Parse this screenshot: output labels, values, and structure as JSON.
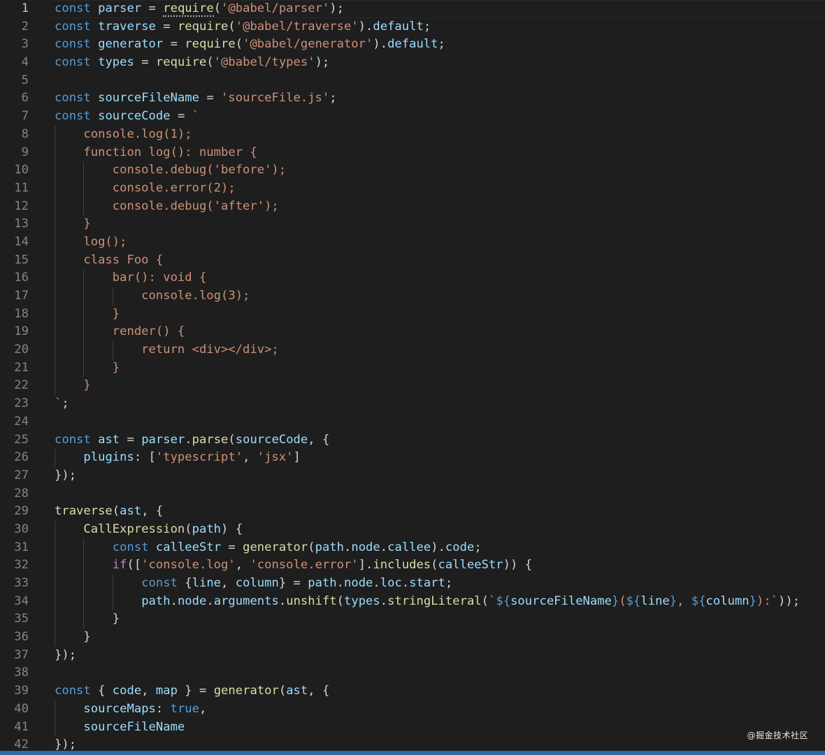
{
  "editor": {
    "current_line": 1,
    "lines": [
      {
        "n": "1",
        "indent": 0,
        "t": [
          [
            "kw",
            "const"
          ],
          [
            "p",
            " "
          ],
          [
            "var",
            "parser"
          ],
          [
            "p",
            " = "
          ],
          [
            "fn",
            "require"
          ],
          [
            "p",
            "("
          ],
          [
            "str",
            "'@babel/parser'"
          ],
          [
            "p",
            ");"
          ]
        ]
      },
      {
        "n": "2",
        "indent": 0,
        "t": [
          [
            "kw",
            "const"
          ],
          [
            "p",
            " "
          ],
          [
            "var",
            "traverse"
          ],
          [
            "p",
            " = "
          ],
          [
            "fn",
            "require"
          ],
          [
            "p",
            "("
          ],
          [
            "str",
            "'@babel/traverse'"
          ],
          [
            "p",
            ")."
          ],
          [
            "prop",
            "default"
          ],
          [
            "p",
            ";"
          ]
        ]
      },
      {
        "n": "3",
        "indent": 0,
        "t": [
          [
            "kw",
            "const"
          ],
          [
            "p",
            " "
          ],
          [
            "var",
            "generator"
          ],
          [
            "p",
            " = "
          ],
          [
            "fn",
            "require"
          ],
          [
            "p",
            "("
          ],
          [
            "str",
            "'@babel/generator'"
          ],
          [
            "p",
            ")."
          ],
          [
            "prop",
            "default"
          ],
          [
            "p",
            ";"
          ]
        ]
      },
      {
        "n": "4",
        "indent": 0,
        "t": [
          [
            "kw",
            "const"
          ],
          [
            "p",
            " "
          ],
          [
            "var",
            "types"
          ],
          [
            "p",
            " = "
          ],
          [
            "fn",
            "require"
          ],
          [
            "p",
            "("
          ],
          [
            "str",
            "'@babel/types'"
          ],
          [
            "p",
            ");"
          ]
        ]
      },
      {
        "n": "5",
        "indent": 0,
        "t": []
      },
      {
        "n": "6",
        "indent": 0,
        "t": [
          [
            "kw",
            "const"
          ],
          [
            "p",
            " "
          ],
          [
            "var",
            "sourceFileName"
          ],
          [
            "p",
            " = "
          ],
          [
            "str",
            "'sourceFile.js'"
          ],
          [
            "p",
            ";"
          ]
        ]
      },
      {
        "n": "7",
        "indent": 0,
        "t": [
          [
            "kw",
            "const"
          ],
          [
            "p",
            " "
          ],
          [
            "var",
            "sourceCode"
          ],
          [
            "p",
            " = "
          ],
          [
            "str",
            "`"
          ]
        ]
      },
      {
        "n": "8",
        "indent": 1,
        "t": [
          [
            "str",
            "    console.log(1);"
          ]
        ]
      },
      {
        "n": "9",
        "indent": 1,
        "t": [
          [
            "str",
            "    function log(): number {"
          ]
        ]
      },
      {
        "n": "10",
        "indent": 2,
        "t": [
          [
            "str",
            "        console.debug('before');"
          ]
        ]
      },
      {
        "n": "11",
        "indent": 2,
        "t": [
          [
            "str",
            "        console.error(2);"
          ]
        ]
      },
      {
        "n": "12",
        "indent": 2,
        "t": [
          [
            "str",
            "        console.debug('after');"
          ]
        ]
      },
      {
        "n": "13",
        "indent": 1,
        "t": [
          [
            "str",
            "    }"
          ]
        ]
      },
      {
        "n": "14",
        "indent": 1,
        "t": [
          [
            "str",
            "    log();"
          ]
        ]
      },
      {
        "n": "15",
        "indent": 1,
        "t": [
          [
            "str",
            "    class Foo {"
          ]
        ]
      },
      {
        "n": "16",
        "indent": 2,
        "t": [
          [
            "str",
            "        bar(): void {"
          ]
        ]
      },
      {
        "n": "17",
        "indent": 3,
        "t": [
          [
            "str",
            "            console.log(3);"
          ]
        ]
      },
      {
        "n": "18",
        "indent": 2,
        "t": [
          [
            "str",
            "        }"
          ]
        ]
      },
      {
        "n": "19",
        "indent": 2,
        "t": [
          [
            "str",
            "        render() {"
          ]
        ]
      },
      {
        "n": "20",
        "indent": 3,
        "t": [
          [
            "str",
            "            return <div></div>;"
          ]
        ]
      },
      {
        "n": "21",
        "indent": 2,
        "t": [
          [
            "str",
            "        }"
          ]
        ]
      },
      {
        "n": "22",
        "indent": 1,
        "t": [
          [
            "str",
            "    }"
          ]
        ]
      },
      {
        "n": "23",
        "indent": 0,
        "t": [
          [
            "str",
            "`"
          ],
          [
            "p",
            ";"
          ]
        ]
      },
      {
        "n": "24",
        "indent": 0,
        "t": []
      },
      {
        "n": "25",
        "indent": 0,
        "t": [
          [
            "kw",
            "const"
          ],
          [
            "p",
            " "
          ],
          [
            "var",
            "ast"
          ],
          [
            "p",
            " = "
          ],
          [
            "var",
            "parser"
          ],
          [
            "p",
            "."
          ],
          [
            "fn",
            "parse"
          ],
          [
            "p",
            "("
          ],
          [
            "var",
            "sourceCode"
          ],
          [
            "p",
            ", {"
          ]
        ]
      },
      {
        "n": "26",
        "indent": 1,
        "t": [
          [
            "p",
            "    "
          ],
          [
            "prop",
            "plugins"
          ],
          [
            "p",
            ": ["
          ],
          [
            "str",
            "'typescript'"
          ],
          [
            "p",
            ", "
          ],
          [
            "str",
            "'jsx'"
          ],
          [
            "p",
            "]"
          ]
        ]
      },
      {
        "n": "27",
        "indent": 0,
        "t": [
          [
            "p",
            "});"
          ]
        ]
      },
      {
        "n": "28",
        "indent": 0,
        "t": []
      },
      {
        "n": "29",
        "indent": 0,
        "t": [
          [
            "fn",
            "traverse"
          ],
          [
            "p",
            "("
          ],
          [
            "var",
            "ast"
          ],
          [
            "p",
            ", {"
          ]
        ]
      },
      {
        "n": "30",
        "indent": 1,
        "t": [
          [
            "p",
            "    "
          ],
          [
            "fn",
            "CallExpression"
          ],
          [
            "p",
            "("
          ],
          [
            "var",
            "path"
          ],
          [
            "p",
            ") {"
          ]
        ]
      },
      {
        "n": "31",
        "indent": 2,
        "t": [
          [
            "p",
            "        "
          ],
          [
            "kw",
            "const"
          ],
          [
            "p",
            " "
          ],
          [
            "var",
            "calleeStr"
          ],
          [
            "p",
            " = "
          ],
          [
            "fn",
            "generator"
          ],
          [
            "p",
            "("
          ],
          [
            "var",
            "path"
          ],
          [
            "p",
            "."
          ],
          [
            "prop",
            "node"
          ],
          [
            "p",
            "."
          ],
          [
            "prop",
            "callee"
          ],
          [
            "p",
            ")."
          ],
          [
            "prop",
            "code"
          ],
          [
            "p",
            ";"
          ]
        ]
      },
      {
        "n": "32",
        "indent": 2,
        "t": [
          [
            "p",
            "        "
          ],
          [
            "ctl",
            "if"
          ],
          [
            "p",
            "(["
          ],
          [
            "str",
            "'console.log'"
          ],
          [
            "p",
            ", "
          ],
          [
            "str",
            "'console.error'"
          ],
          [
            "p",
            "]."
          ],
          [
            "fn",
            "includes"
          ],
          [
            "p",
            "("
          ],
          [
            "var",
            "calleeStr"
          ],
          [
            "p",
            ")) {"
          ]
        ]
      },
      {
        "n": "33",
        "indent": 3,
        "t": [
          [
            "p",
            "            "
          ],
          [
            "kw",
            "const"
          ],
          [
            "p",
            " {"
          ],
          [
            "var",
            "line"
          ],
          [
            "p",
            ", "
          ],
          [
            "var",
            "column"
          ],
          [
            "p",
            "} = "
          ],
          [
            "var",
            "path"
          ],
          [
            "p",
            "."
          ],
          [
            "prop",
            "node"
          ],
          [
            "p",
            "."
          ],
          [
            "prop",
            "loc"
          ],
          [
            "p",
            "."
          ],
          [
            "prop",
            "start"
          ],
          [
            "p",
            ";"
          ]
        ]
      },
      {
        "n": "34",
        "indent": 3,
        "t": [
          [
            "p",
            "            "
          ],
          [
            "var",
            "path"
          ],
          [
            "p",
            "."
          ],
          [
            "prop",
            "node"
          ],
          [
            "p",
            "."
          ],
          [
            "prop",
            "arguments"
          ],
          [
            "p",
            "."
          ],
          [
            "fn",
            "unshift"
          ],
          [
            "p",
            "("
          ],
          [
            "var",
            "types"
          ],
          [
            "p",
            "."
          ],
          [
            "fn",
            "stringLiteral"
          ],
          [
            "p",
            "("
          ],
          [
            "str",
            "`"
          ],
          [
            "kw",
            "${"
          ],
          [
            "var",
            "sourceFileName"
          ],
          [
            "kw",
            "}"
          ],
          [
            "str",
            "("
          ],
          [
            "kw",
            "${"
          ],
          [
            "var",
            "line"
          ],
          [
            "kw",
            "}"
          ],
          [
            "str",
            ", "
          ],
          [
            "kw",
            "${"
          ],
          [
            "var",
            "column"
          ],
          [
            "kw",
            "}"
          ],
          [
            "str",
            "):`"
          ],
          [
            "p",
            "));"
          ]
        ]
      },
      {
        "n": "35",
        "indent": 2,
        "t": [
          [
            "p",
            "        }"
          ]
        ]
      },
      {
        "n": "36",
        "indent": 1,
        "t": [
          [
            "p",
            "    }"
          ]
        ]
      },
      {
        "n": "37",
        "indent": 0,
        "t": [
          [
            "p",
            "});"
          ]
        ]
      },
      {
        "n": "38",
        "indent": 0,
        "t": []
      },
      {
        "n": "39",
        "indent": 0,
        "t": [
          [
            "kw",
            "const"
          ],
          [
            "p",
            " { "
          ],
          [
            "var",
            "code"
          ],
          [
            "p",
            ", "
          ],
          [
            "var",
            "map"
          ],
          [
            "p",
            " } = "
          ],
          [
            "fn",
            "generator"
          ],
          [
            "p",
            "("
          ],
          [
            "var",
            "ast"
          ],
          [
            "p",
            ", {"
          ]
        ]
      },
      {
        "n": "40",
        "indent": 1,
        "t": [
          [
            "p",
            "    "
          ],
          [
            "prop",
            "sourceMaps"
          ],
          [
            "p",
            ": "
          ],
          [
            "kw",
            "true"
          ],
          [
            "p",
            ","
          ]
        ]
      },
      {
        "n": "41",
        "indent": 1,
        "t": [
          [
            "p",
            "    "
          ],
          [
            "var",
            "sourceFileName"
          ]
        ]
      },
      {
        "n": "42",
        "indent": 0,
        "t": [
          [
            "p",
            "});"
          ]
        ]
      }
    ]
  },
  "watermark": "@掘金技术社区",
  "theme": {
    "background": "#1e1e1e",
    "status_bar": "#2d6aa8",
    "keyword": "#569cd6",
    "string": "#ce9178",
    "variable": "#9cdcfe",
    "function": "#dcdcaa"
  }
}
